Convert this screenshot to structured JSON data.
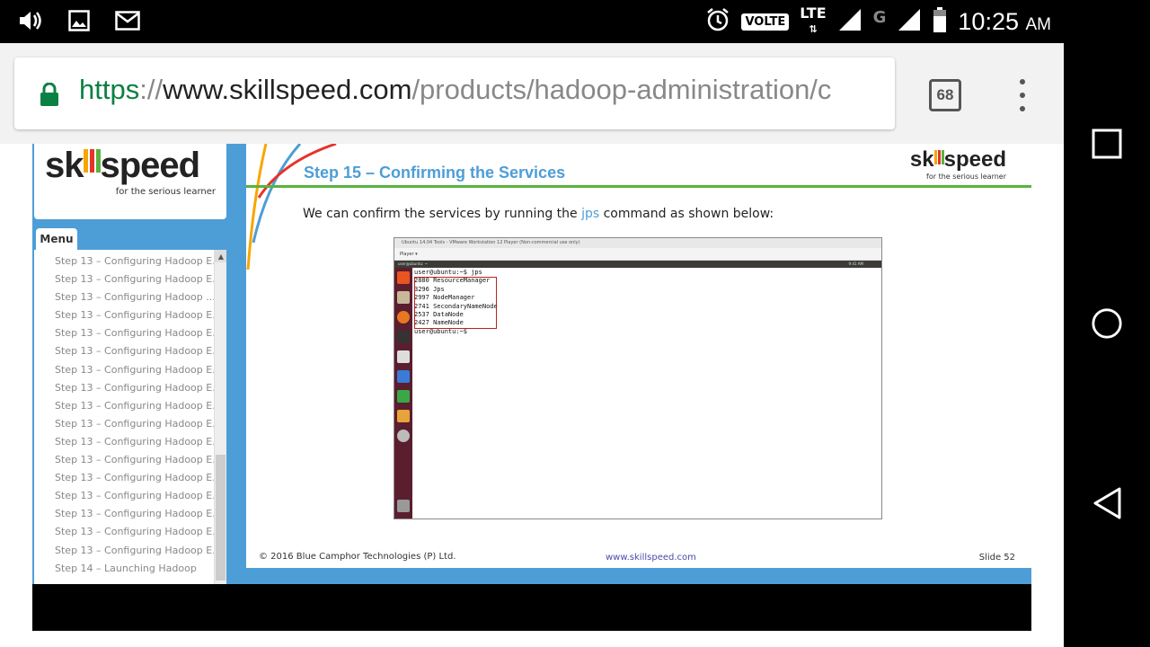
{
  "status_bar": {
    "left_icons": [
      "volume-icon",
      "image-icon",
      "gmail-icon"
    ],
    "volte": "VOLTE",
    "lte": "LTE",
    "network_g": "G",
    "time": "10:25",
    "ampm": "AM"
  },
  "browser": {
    "url_scheme": "https",
    "url_sep": "://",
    "url_host": "www.skillspeed.com",
    "url_path": "/products/hadoop-administration/c",
    "tab_count": "68"
  },
  "sidebar": {
    "brand_prefix": "sk",
    "brand_suffix": "speed",
    "tagline": "for the serious learner",
    "menu_label": "Menu",
    "items": [
      "Step 13 – Configuring Hadoop E...",
      "Step 13 – Configuring Hadoop E...",
      "Step 13  – Configuring Hadoop ...",
      "Step 13 – Configuring Hadoop E...",
      "Step 13 – Configuring Hadoop E...",
      "Step 13 – Configuring Hadoop E...",
      "Step 13 – Configuring Hadoop E...",
      "Step 13 – Configuring Hadoop E...",
      "Step 13 – Configuring Hadoop E...",
      "Step 13 – Configuring Hadoop E...",
      "Step 13 – Configuring Hadoop E...",
      "Step 13 – Configuring Hadoop E...",
      "Step 13 – Configuring Hadoop E...",
      "Step 13 – Configuring Hadoop E...",
      "Step 13 – Configuring Hadoop E...",
      "Step 13 – Configuring Hadoop E...",
      "Step 13 – Configuring Hadoop E...",
      "Step 14 – Launching Hadoop"
    ]
  },
  "slide": {
    "title": "Step 15 – Confirming the Services",
    "brand_prefix": "sk",
    "brand_suffix": "speed",
    "tagline": "for the serious learner",
    "body_before": "We can confirm the services by running the ",
    "body_keyword": "jps",
    "body_after": " command as shown below:",
    "vm_title": "Ubuntu 14.04 Tools - VMware Workstation 12 Player (Non-commercial use only)",
    "vm_toolbar": "Player ▾",
    "vm_topbar_left": "user@ubuntu: ~",
    "vm_topbar_right": "9:41 AM",
    "terminal_lines": [
      "user@ubuntu:~$ jps",
      "2880 ResourceManager",
      "3296 Jps",
      "2997 NodeManager",
      "2741 SecondaryNameNode",
      "2537 DataNode",
      "2427 NameNode",
      "user@ubuntu:~$"
    ],
    "footer_copyright": "© 2016 Blue Camphor Technologies (P) Ltd.",
    "footer_url": "www.skillspeed.com",
    "footer_slide": "Slide 52"
  },
  "colors": {
    "player_blue": "#4d9ed7",
    "rule_green": "#58b33e",
    "https_green": "#0b8043"
  }
}
